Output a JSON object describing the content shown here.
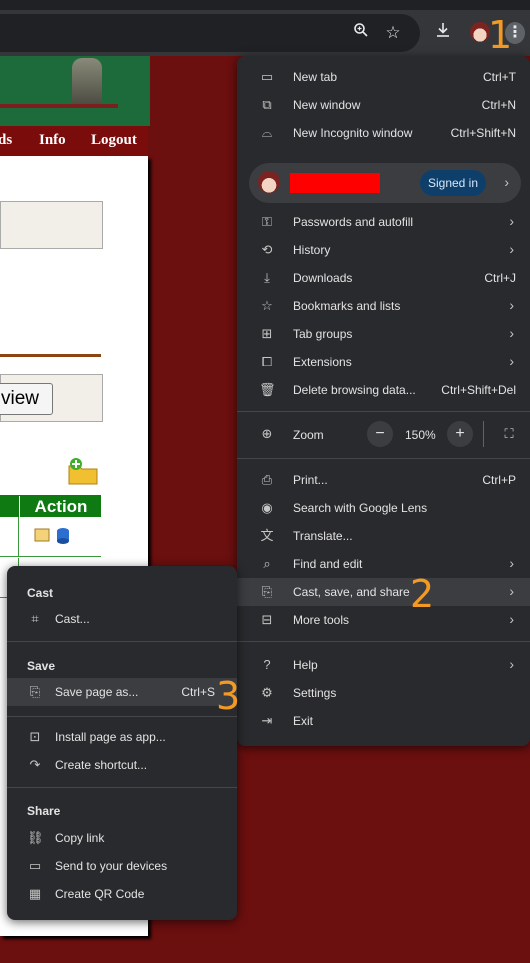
{
  "toolbar": {
    "icons": [
      "zoom-icon",
      "bookmark-star-icon",
      "download-icon",
      "avatar",
      "more-menu-icon"
    ]
  },
  "annotations": {
    "step1": "1",
    "step2": "2",
    "step3": "3"
  },
  "page": {
    "nav_partial": "ds",
    "nav_info": "Info",
    "nav_logout": "Logout",
    "view_button": "view",
    "table_action_header": "Action"
  },
  "menu": {
    "new_tab": {
      "label": "New tab",
      "shortcut": "Ctrl+T"
    },
    "new_window": {
      "label": "New window",
      "shortcut": "Ctrl+N"
    },
    "new_incognito": {
      "label": "New Incognito window",
      "shortcut": "Ctrl+Shift+N"
    },
    "profile": {
      "badge": "Signed in"
    },
    "passwords": {
      "label": "Passwords and autofill"
    },
    "history": {
      "label": "History"
    },
    "downloads": {
      "label": "Downloads",
      "shortcut": "Ctrl+J"
    },
    "bookmarks": {
      "label": "Bookmarks and lists"
    },
    "tab_groups": {
      "label": "Tab groups"
    },
    "extensions": {
      "label": "Extensions"
    },
    "delete_data": {
      "label": "Delete browsing data...",
      "shortcut": "Ctrl+Shift+Del"
    },
    "zoom": {
      "label": "Zoom",
      "value": "150%",
      "minus": "−",
      "plus": "+"
    },
    "print": {
      "label": "Print...",
      "shortcut": "Ctrl+P"
    },
    "lens": {
      "label": "Search with Google Lens"
    },
    "translate": {
      "label": "Translate..."
    },
    "find_edit": {
      "label": "Find and edit"
    },
    "cast_save_share": {
      "label": "Cast, save, and share"
    },
    "more_tools": {
      "label": "More tools"
    },
    "help": {
      "label": "Help"
    },
    "settings": {
      "label": "Settings"
    },
    "exit": {
      "label": "Exit"
    }
  },
  "submenu": {
    "cast_header": "Cast",
    "cast": {
      "label": "Cast..."
    },
    "save_header": "Save",
    "save_page": {
      "label": "Save page as...",
      "shortcut": "Ctrl+S"
    },
    "install_app": {
      "label": "Install page as app..."
    },
    "create_shortcut": {
      "label": "Create shortcut..."
    },
    "share_header": "Share",
    "copy_link": {
      "label": "Copy link"
    },
    "send_devices": {
      "label": "Send to your devices"
    },
    "qr_code": {
      "label": "Create QR Code"
    }
  }
}
